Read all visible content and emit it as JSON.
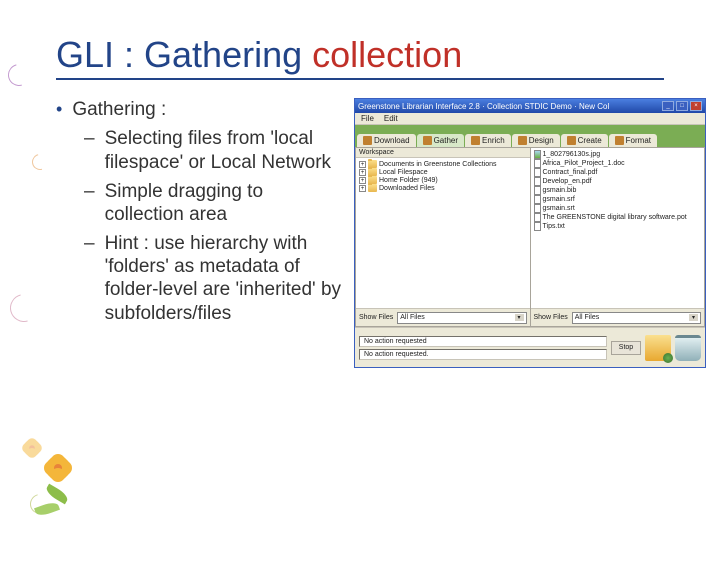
{
  "slide": {
    "title_prefix": "GLI : Gathering ",
    "title_colored": "collection",
    "bullet": "Gathering :",
    "subs": [
      "Selecting files from 'local filespace' or Local Network",
      "Simple dragging to collection area",
      "Hint : use hierarchy with 'folders' as metadata of folder-level are 'inherited' by subfolders/files"
    ]
  },
  "app": {
    "window_title": "Greenstone Librarian Interface 2.8 · Collection STDIC Demo · New Col",
    "menu": {
      "file": "File",
      "edit": "Edit"
    },
    "tabs": {
      "download": "Download",
      "gather": "Gather",
      "enrich": "Enrich",
      "design": "Design",
      "create": "Create",
      "format": "Format"
    },
    "workspace_label": "Workspace",
    "tree_left": [
      "Documents in Greenstone Collections",
      "Local Filespace",
      "Home Folder (949)",
      "Downloaded Files"
    ],
    "tree_right": [
      {
        "name": "1_802796130s.jpg",
        "type": "img"
      },
      {
        "name": "Africa_Pilot_Project_1.doc",
        "type": "doc"
      },
      {
        "name": "Contract_final.pdf",
        "type": "doc"
      },
      {
        "name": "Develop_en.pdf",
        "type": "doc"
      },
      {
        "name": "gsmain.bib",
        "type": "doc"
      },
      {
        "name": "gsmain.srf",
        "type": "doc"
      },
      {
        "name": "gsmain.srt",
        "type": "doc"
      },
      {
        "name": "The GREENSTONE digital library software.pot",
        "type": "doc"
      },
      {
        "name": "Tips.txt",
        "type": "doc"
      }
    ],
    "filter_left_label": "Show Files",
    "filter_right_label": "Show Files",
    "filter_value": "All Files",
    "status_left": "No action requested",
    "status_right": "No action requested.",
    "stop": "Stop"
  }
}
